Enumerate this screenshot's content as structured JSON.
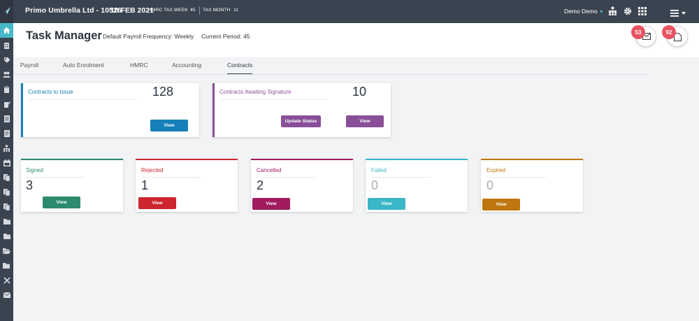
{
  "topbar": {
    "company": "Primo Umbrella Ltd  - 10526",
    "date": "10 FEB 2021",
    "tax_week_label": "HMRC TAX WEEK",
    "tax_week_value": "45",
    "tax_month_label": "TAX MONTH",
    "tax_month_value": "11",
    "user": "Demo Demo",
    "icons": [
      "org-chart-icon",
      "gear-icon",
      "apps-grid-icon",
      "hamburger-menu-icon"
    ]
  },
  "header": {
    "title": "Task Manager",
    "payroll_frequency": "Default Payroll Frequency: Weekly",
    "current_period": "Current Period: 45",
    "messages_badge": "53",
    "documents_badge": "92"
  },
  "tabs": [
    "Payroll",
    "Auto Enrolment",
    "HMRC",
    "Accounting",
    "Contracts"
  ],
  "active_tab": "Contracts",
  "contracts_to_issue": {
    "label": "Contracts to Issue",
    "count": "128",
    "view_label": "View",
    "color": "#1580b8"
  },
  "contracts_awaiting": {
    "label": "Contracts Awaiting Signature",
    "count": "10",
    "update_label": "Update Status",
    "view_label": "View",
    "color": "#8a4f99"
  },
  "status_cards": [
    {
      "label": "Signed",
      "count": "3",
      "view_label": "View",
      "color": "#2c8a6e"
    },
    {
      "label": "Rejected",
      "count": "1",
      "view_label": "View",
      "color": "#cc2530"
    },
    {
      "label": "Cancelled",
      "count": "2",
      "view_label": "View",
      "color": "#a01c5e"
    },
    {
      "label": "Failed",
      "count": "0",
      "view_label": "View",
      "color": "#3bb6c6"
    },
    {
      "label": "Expired",
      "count": "0",
      "view_label": "View",
      "color": "#bf7610"
    }
  ],
  "colors": {
    "topbar": "#3a4350",
    "accent": "#47b8c8",
    "badge": "#e65461"
  }
}
